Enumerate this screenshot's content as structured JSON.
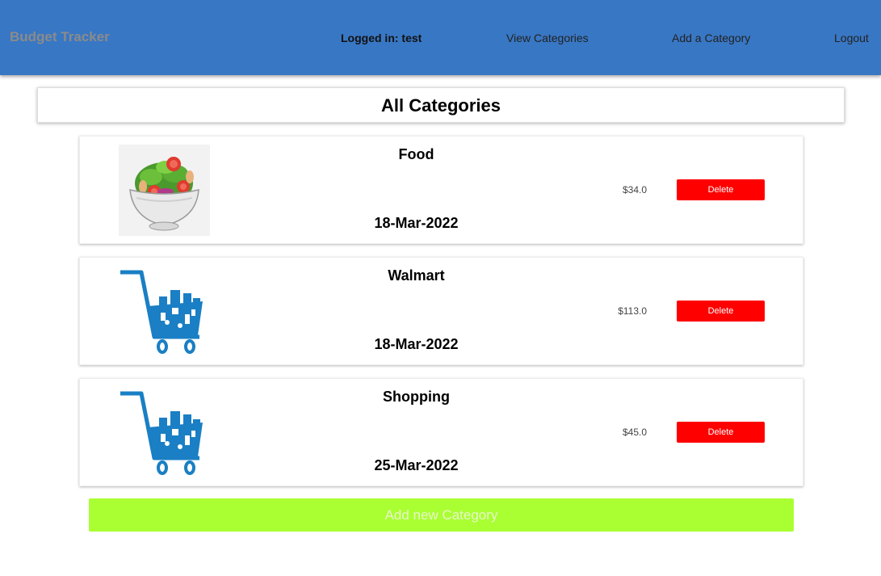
{
  "nav": {
    "brand": "Budget Tracker",
    "user_status": "Logged in: test",
    "view_categories": "View Categories",
    "add_category": "Add a Category",
    "logout": "Logout"
  },
  "page_title": "All Categories",
  "categories": [
    {
      "name": "Food",
      "date": "18-Mar-2022",
      "amount": "$34.0",
      "delete_label": "Delete",
      "icon": "salad-bowl-icon"
    },
    {
      "name": "Walmart",
      "date": "18-Mar-2022",
      "amount": "$113.0",
      "delete_label": "Delete",
      "icon": "shopping-cart-icon"
    },
    {
      "name": "Shopping",
      "date": "25-Mar-2022",
      "amount": "$45.0",
      "delete_label": "Delete",
      "icon": "shopping-cart-icon"
    }
  ],
  "add_button_label": "Add new Category",
  "colors": {
    "navbar": "#3877c4",
    "delete": "#ff0000",
    "add_button": "#aaff33",
    "cart": "#1a7fc4"
  }
}
